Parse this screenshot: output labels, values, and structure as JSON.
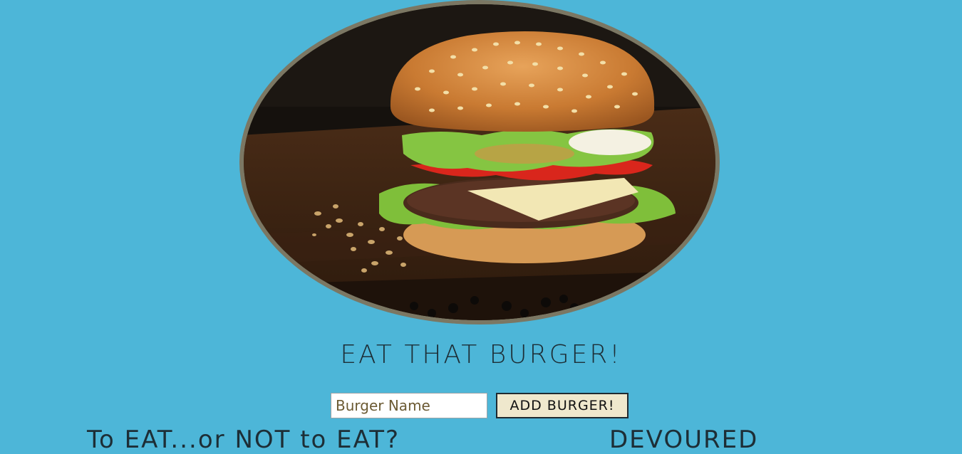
{
  "hero": {
    "icon": "burger-image"
  },
  "header": {
    "title": "EAT THAT BURGER!"
  },
  "form": {
    "input_placeholder": "Burger Name",
    "input_value": "",
    "add_button_label": "ADD BURGER!"
  },
  "columns": {
    "to_eat_heading": "To EAT...or NOT to EAT?",
    "devoured_heading": "DEVOURED"
  },
  "colors": {
    "background": "#4db6d8",
    "hero_border": "#7b7763",
    "button_bg": "#efe8cd"
  }
}
